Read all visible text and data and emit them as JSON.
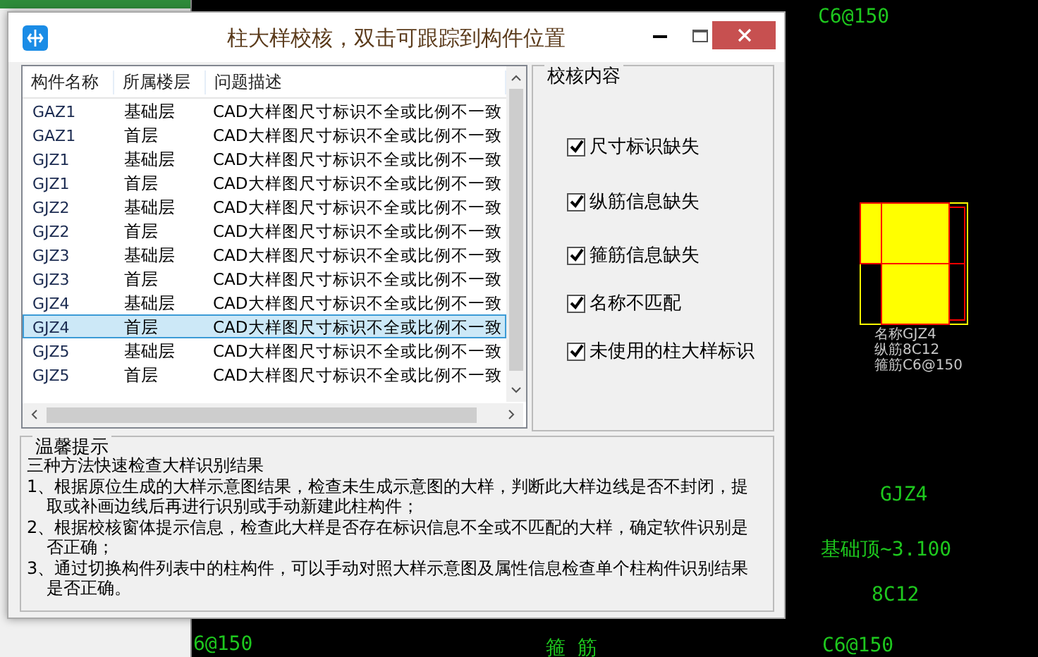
{
  "window": {
    "title": "柱大样校核，双击可跟踪到构件位置"
  },
  "table": {
    "columns": [
      "构件名称",
      "所属楼层",
      "问题描述"
    ],
    "rows": [
      {
        "name": "GAZ1",
        "floor": "基础层",
        "problem": "CAD大样图尺寸标识不全或比例不一致",
        "selected": false
      },
      {
        "name": "GAZ1",
        "floor": "首层",
        "problem": "CAD大样图尺寸标识不全或比例不一致",
        "selected": false
      },
      {
        "name": "GJZ1",
        "floor": "基础层",
        "problem": "CAD大样图尺寸标识不全或比例不一致",
        "selected": false
      },
      {
        "name": "GJZ1",
        "floor": "首层",
        "problem": "CAD大样图尺寸标识不全或比例不一致",
        "selected": false
      },
      {
        "name": "GJZ2",
        "floor": "基础层",
        "problem": "CAD大样图尺寸标识不全或比例不一致",
        "selected": false
      },
      {
        "name": "GJZ2",
        "floor": "首层",
        "problem": "CAD大样图尺寸标识不全或比例不一致",
        "selected": false
      },
      {
        "name": "GJZ3",
        "floor": "基础层",
        "problem": "CAD大样图尺寸标识不全或比例不一致",
        "selected": false
      },
      {
        "name": "GJZ3",
        "floor": "首层",
        "problem": "CAD大样图尺寸标识不全或比例不一致",
        "selected": false
      },
      {
        "name": "GJZ4",
        "floor": "基础层",
        "problem": "CAD大样图尺寸标识不全或比例不一致",
        "selected": false
      },
      {
        "name": "GJZ4",
        "floor": "首层",
        "problem": "CAD大样图尺寸标识不全或比例不一致",
        "selected": true
      },
      {
        "name": "GJZ5",
        "floor": "基础层",
        "problem": "CAD大样图尺寸标识不全或比例不一致",
        "selected": false
      },
      {
        "name": "GJZ5",
        "floor": "首层",
        "problem": "CAD大样图尺寸标识不全或比例不一致",
        "selected": false
      }
    ]
  },
  "check_panel": {
    "title": "校核内容",
    "options": [
      {
        "label": "尺寸标识缺失",
        "checked": true
      },
      {
        "label": "纵筋信息缺失",
        "checked": true
      },
      {
        "label": "箍筋信息缺失",
        "checked": true
      },
      {
        "label": "名称不匹配",
        "checked": true
      },
      {
        "label": "未使用的柱大样标识",
        "checked": true
      }
    ]
  },
  "tips": {
    "title": "温馨提示",
    "intro": "三种方法快速检查大样识别结果",
    "items": [
      "1、根据原位生成的大样示意图结果，检查未生成示意图的大样，判断此大样边线是否不封闭，提取或补画边线后再进行识别或手动新建此柱构件；",
      "2、根据校核窗体提示信息，检查此大样是否存在标识信息不全或不匹配的大样，确定软件识别是否正确；",
      "3、通过切换构件列表中的柱构件，可以手动对照大样示意图及属性信息检查单个柱构件识别结果是否正确。"
    ]
  },
  "cad": {
    "labels": [
      "C6@150",
      "GJZ4",
      "基础顶~3.100",
      "8C12",
      "6@150",
      "箍 筋",
      "C6@150"
    ],
    "detail_notes": [
      "名称GJZ4",
      "纵筋8C12",
      "箍筋C6@150"
    ]
  }
}
